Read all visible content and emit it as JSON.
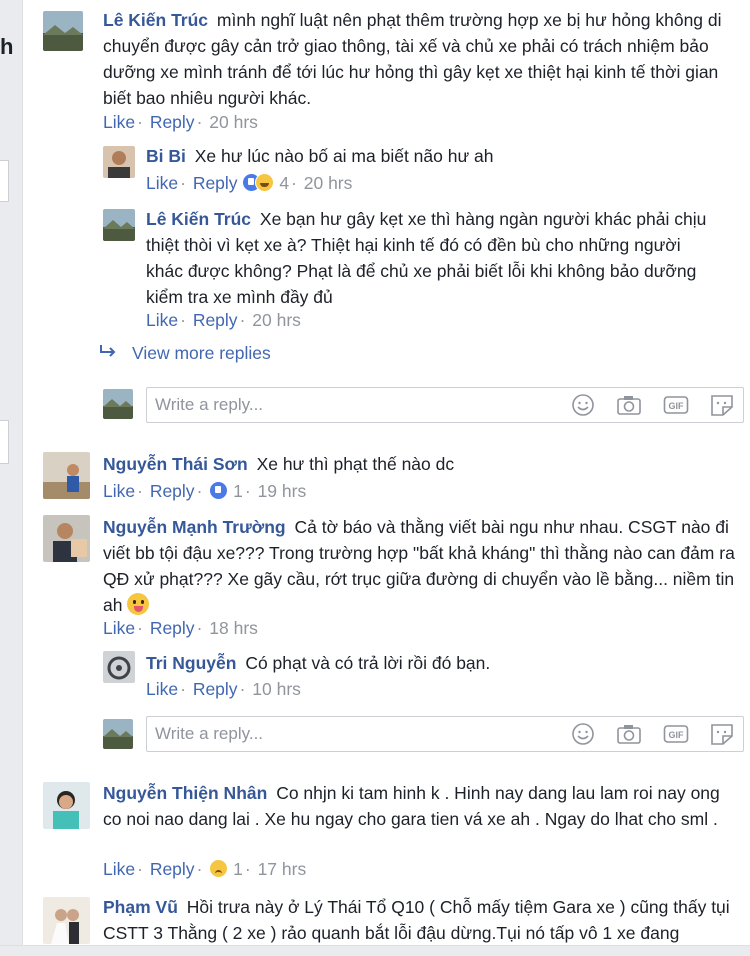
{
  "left_strip": {
    "fragment": "h"
  },
  "comments": [
    {
      "name": "Lê Kiến Trúc",
      "text": "mình nghĩ luật nên phạt thêm trường hợp xe bị hư hỏng không di chuyển được gây cản trở giao thông, tài xế và chủ xe phải có trách nhiệm bảo dưỡng xe mình tránh để tới lúc hư hỏng thì gây kẹt xe thiệt hại kinh tế thời gian biết bao nhiêu người khác.",
      "like": "Like",
      "reply": "Reply",
      "time": "20 hrs",
      "avatar": "landscape"
    },
    {
      "name": "Bi Bi",
      "text": "Xe hư lúc nào bố ai ma biết não hư ah",
      "like": "Like",
      "reply": "Reply",
      "reactions": [
        "like",
        "haha"
      ],
      "reaction_count": "4",
      "time": "20 hrs",
      "avatar": "person"
    },
    {
      "name": "Lê Kiến Trúc",
      "text": "Xe bạn hư gây kẹt xe thì hàng ngàn người khác phải chịu thiệt thòi vì kẹt xe à? Thiệt hại kinh tế đó có đền bù cho những người khác được không? Phạt là để chủ xe phải biết lỗi khi không bảo dưỡng kiểm tra xe mình đầy đủ",
      "like": "Like",
      "reply": "Reply",
      "time": "20 hrs",
      "avatar": "landscape"
    },
    {
      "name": "Nguyễn Thái Sơn",
      "text": "Xe hư thì phạt thế nào dc",
      "like": "Like",
      "reply": "Reply",
      "reactions": [
        "like"
      ],
      "reaction_count": "1",
      "time": "19 hrs",
      "avatar": "person"
    },
    {
      "name": "Nguyễn Mạnh Trường",
      "text": "Cả tờ báo và thằng viết bài ngu như nhau. CSGT nào đi viết bb tội đậu xe??? Trong trường hợp \"bất khả kháng\" thì thằng nào can đảm ra QĐ xử phạt??? Xe gãy cầu, rớt trục giữa đường di chuyển vào lề bằng... niềm tin ah",
      "like": "Like",
      "reply": "Reply",
      "time": "18 hrs",
      "avatar": "person"
    },
    {
      "name": "Tri Nguyễn",
      "text": "Có phạt và có trả lời rồi đó bạn.",
      "like": "Like",
      "reply": "Reply",
      "time": "10 hrs",
      "avatar": "car"
    },
    {
      "name": "Nguyễn Thiện Nhân",
      "text": "Co nhjn ki tam hinh k . Hinh nay dang lau lam roi nay ong co noi nao dang lai . Xe hu ngay cho gara tien vá xe ah . Ngay do lhat cho sml .",
      "like": "Like",
      "reply": "Reply",
      "reactions": [
        "sad"
      ],
      "reaction_count": "1",
      "time": "17 hrs",
      "avatar": "person"
    },
    {
      "name": "Phạm Vũ",
      "text": "Hồi trưa này ở Lý Thái Tổ Q10 ( Chỗ mấy tiệm Gara xe ) cũng thấy tụi CSTT 3 Thằng ( 2 xe ) rảo quanh bắt lỗi đậu dừng.Tụi nó tấp vô 1 xe đang",
      "avatar": "wedding"
    }
  ],
  "view_more": "View more replies",
  "reply_box": {
    "placeholder": "Write a reply..."
  },
  "icons": [
    "reply-arrow-icon",
    "emoji-icon",
    "camera-icon",
    "gif-icon",
    "sticker-icon"
  ],
  "colors": {
    "name": "#365899",
    "link": "#4267b2",
    "meta": "#90949c",
    "text": "#1d2129"
  }
}
